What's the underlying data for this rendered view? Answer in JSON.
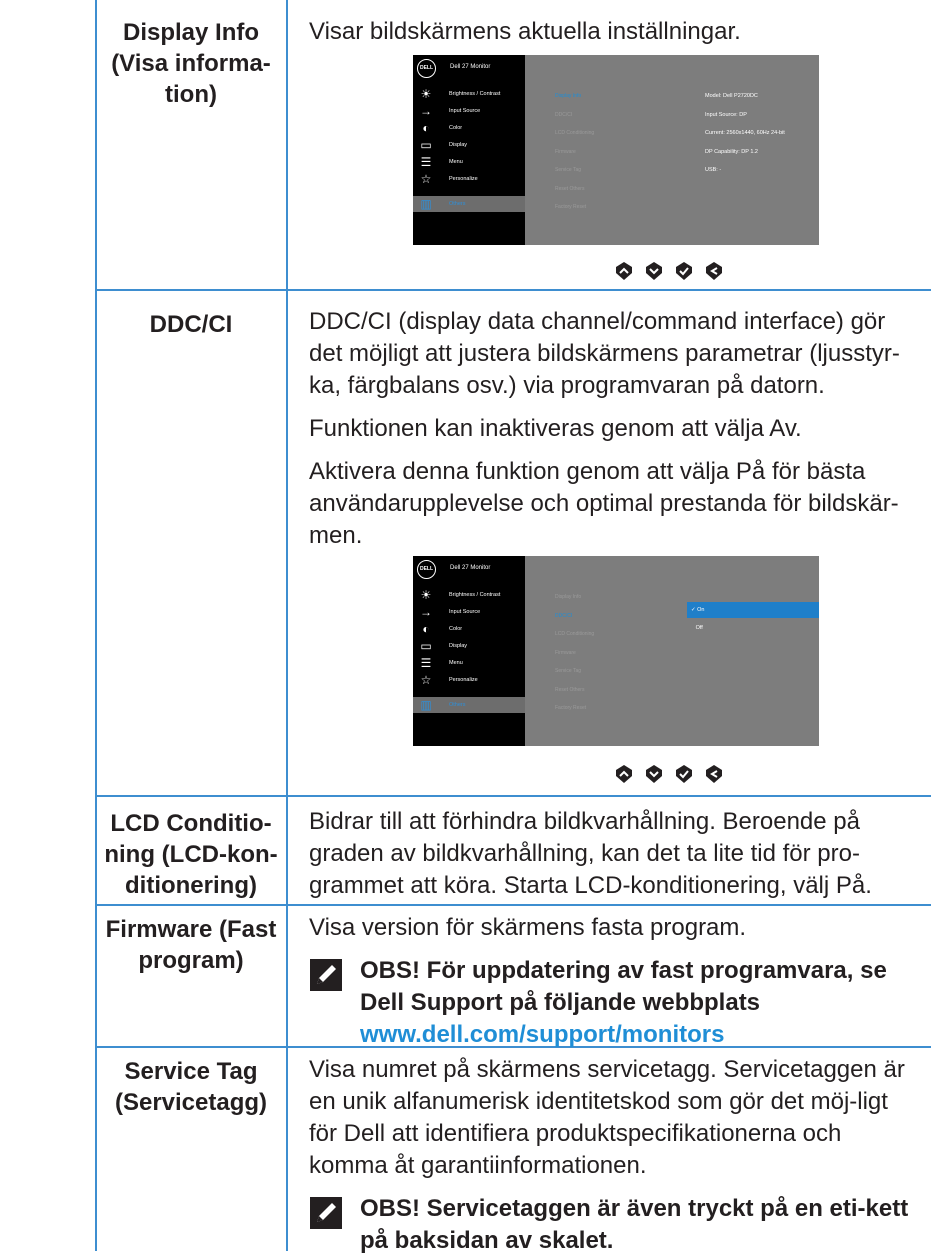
{
  "rows": [
    {
      "label": "Display Info (Visa informa-tion)",
      "label_lines": [
        "Display Info",
        "(Visa informa-",
        "tion)"
      ],
      "paragraphs": [
        "Visar bildskärmens aktuella inställningar."
      ]
    },
    {
      "label": "DDC/CI",
      "label_lines": [
        "DDC/CI"
      ],
      "paragraphs": [
        "DDC/CI (display data channel/command interface) gör det möjligt att justera bildskärmens parametrar (ljusstyr-ka, färgbalans osv.) via programvaran på datorn.",
        "Funktionen kan inaktiveras genom att välja Av.",
        "Aktivera denna funktion genom att välja På för bästa användarupplevelse och optimal prestanda för bildskär-men."
      ]
    },
    {
      "label": "LCD Conditioning (LCD-konditionering)",
      "label_lines": [
        "LCD Conditio-",
        "ning (LCD-kon-",
        "ditionering)"
      ],
      "paragraphs": [
        "Bidrar till att förhindra bildkvarhållning. Beroende på graden av bildkvarhållning, kan det ta lite tid för pro-grammet att köra. Starta LCD-konditionering, välj På."
      ]
    },
    {
      "label": "Firmware (Fast program)",
      "label_lines": [
        "Firmware (Fast",
        "program)"
      ],
      "paragraphs": [
        "Visa version för skärmens fasta program."
      ],
      "note": "OBS! För uppdatering av fast programvara, se Dell Support på följande webbplats",
      "note_link": "www.dell.com/support/monitors"
    },
    {
      "label": "Service Tag (Servicetagg)",
      "label_lines": [
        "Service Tag",
        "(Servicetagg)"
      ],
      "paragraphs": [
        "Visa numret på skärmens servicetagg. Servicetaggen är en unik alfanumerisk identitetskod som gör det möj-ligt för Dell att identifiera produktspecifikationerna och komma åt garantiinformationen."
      ],
      "note": "OBS! Servicetaggen är även tryckt på en eti-kett på baksidan av skalet."
    }
  ],
  "osd": {
    "logo": "DELL",
    "title": "Dell 27 Monitor",
    "menu": [
      "Brightness / Contrast",
      "Input Source",
      "Color",
      "Display",
      "Menu",
      "Personalize",
      "Others"
    ],
    "menu_icons": [
      "brightness-icon",
      "input-source-icon",
      "color-icon",
      "display-icon",
      "menu-icon",
      "personalize-icon",
      "others-icon"
    ],
    "submenu": [
      "Display Info",
      "DDC/CI",
      "LCD Conditioning",
      "Firmware",
      "Service Tag",
      "Reset Others",
      "Factory Reset"
    ],
    "info_values": [
      "Model: Dell P2720DC",
      "Input Source: DP",
      "Current: 2560x1440, 60Hz 24-bit",
      "DP Capability: DP 1.2",
      "USB: -"
    ],
    "ddc_options": [
      "On",
      "Off"
    ],
    "buttons": [
      "up-icon",
      "down-icon",
      "check-icon",
      "back-icon"
    ]
  },
  "colors": {
    "rule": "#3e8ed0",
    "link": "#1f8ed6",
    "osd_bg": "#7d7d7d",
    "osd_side": "#000000"
  }
}
